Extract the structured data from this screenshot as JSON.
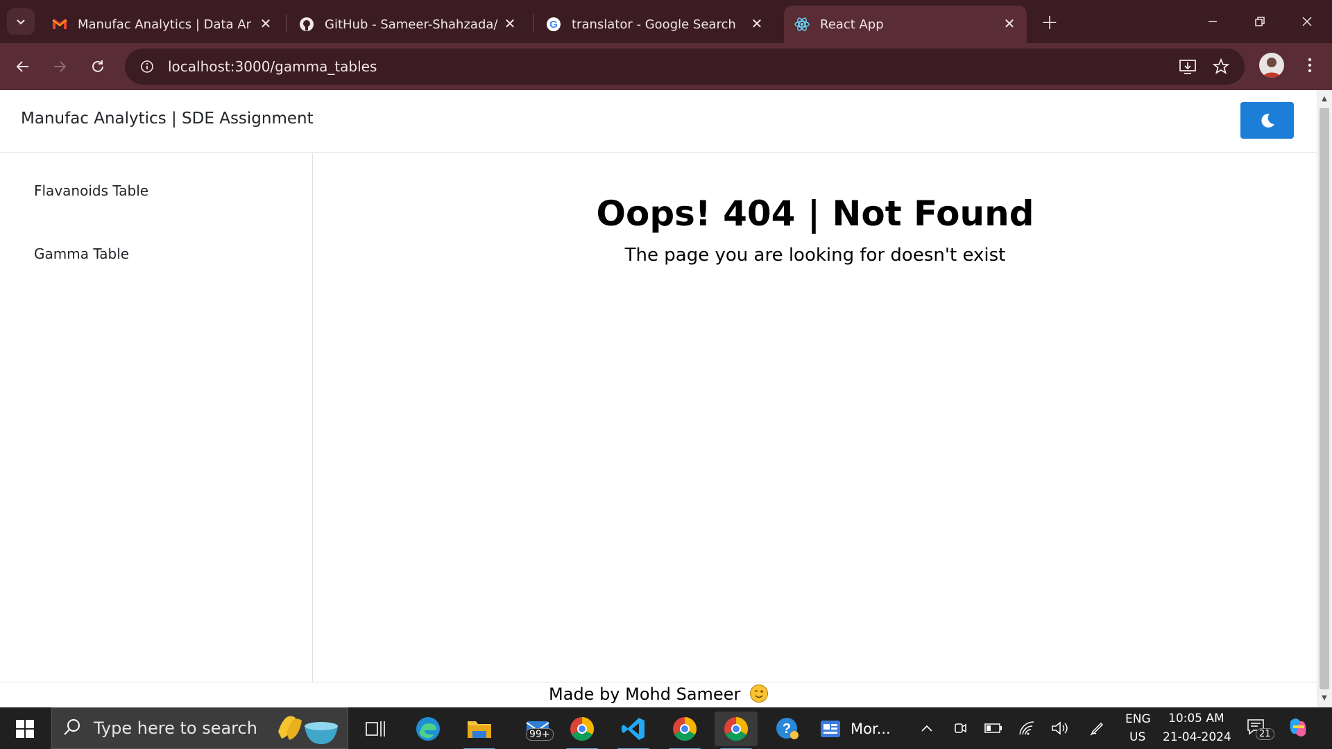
{
  "browser": {
    "tabs": [
      {
        "title": "Manufac Analytics | Data Analy",
        "favicon": "gmail-icon",
        "active": false
      },
      {
        "title": "GitHub - Sameer-Shahzada/Da",
        "favicon": "github-icon",
        "active": false
      },
      {
        "title": "translator - Google Search",
        "favicon": "google-icon",
        "active": false
      },
      {
        "title": "React App",
        "favicon": "react-icon",
        "active": true
      }
    ],
    "address": "localhost:3000/gamma_tables",
    "colors": {
      "frame": "#3a1c22",
      "toolbar": "#5a2c36"
    }
  },
  "navbar": {
    "brand": "Manufac Analytics | SDE Assignment",
    "theme_toggle_icon": "moon-icon",
    "accent": "#1c7ed6"
  },
  "sidebar": {
    "items": [
      {
        "label": "Flavanoids Table"
      },
      {
        "label": "Gamma Table"
      }
    ]
  },
  "main": {
    "title": "Oops! 404 | Not Found",
    "subtitle": "The page you are looking for doesn't exist"
  },
  "footer": {
    "text": "Made by Mohd Sameer",
    "emoji": "winking-face"
  },
  "taskbar": {
    "search_placeholder": "Type here to search",
    "mail_badge": "99+",
    "widget_label": "Mor...",
    "language": "ENG",
    "region": "US",
    "time": "10:05 AM",
    "date": "21-04-2024",
    "notifications": "21"
  }
}
